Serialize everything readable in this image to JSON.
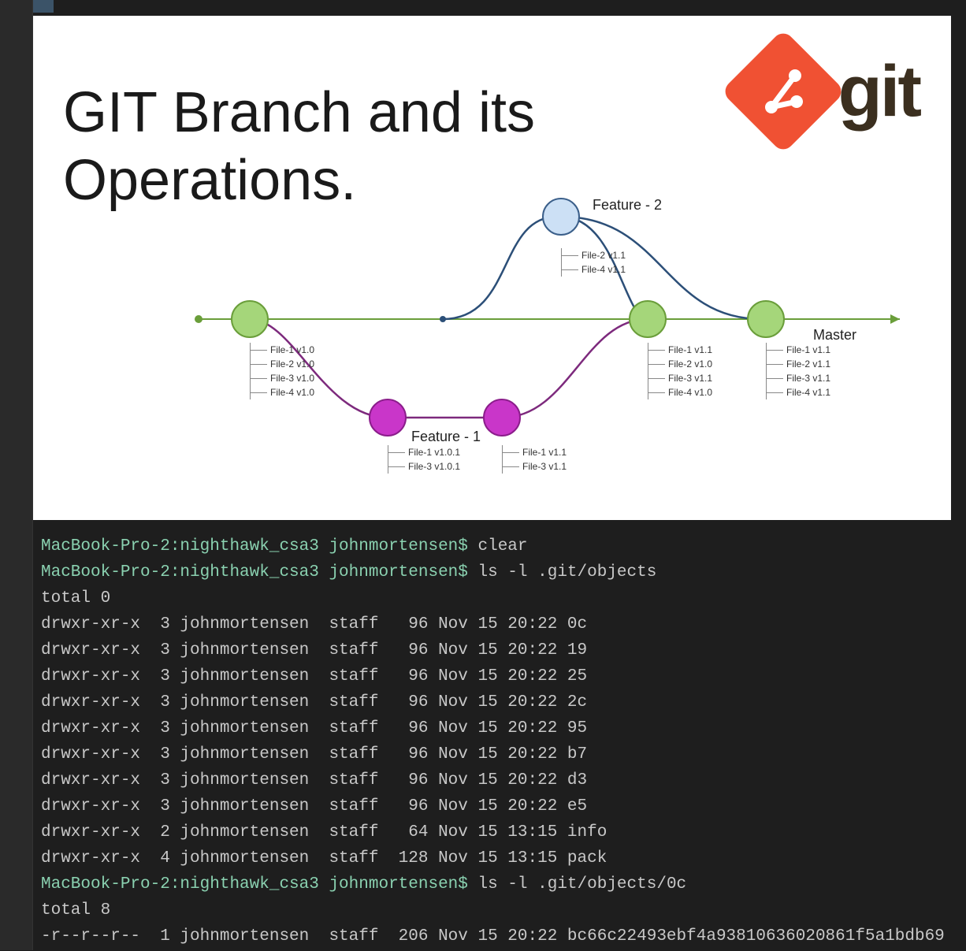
{
  "slide": {
    "title": "GIT Branch and its Operations.",
    "logo_text": "git"
  },
  "diagram": {
    "branch_master": "Master",
    "branch_feature1": "Feature - 1",
    "branch_feature2": "Feature - 2",
    "files_commit1": [
      "File-1 v1.0",
      "File-2 v1.0",
      "File-3 v1.0",
      "File-4 v1.0"
    ],
    "files_feature2": [
      "File-2 v1.1",
      "File-4 v1.1"
    ],
    "files_feature1a": [
      "File-1 v1.0.1",
      "File-3 v1.0.1"
    ],
    "files_feature1b": [
      "File-1 v1.1",
      "File-3 v1.1"
    ],
    "files_commit2": [
      "File-1 v1.1",
      "File-2 v1.0",
      "File-3 v1.1",
      "File-4 v1.0"
    ],
    "files_commit3": [
      "File-1 v1.1",
      "File-2 v1.1",
      "File-3 v1.1",
      "File-4 v1.1"
    ]
  },
  "terminal": {
    "host": "MacBook-Pro-2:nighthawk_csa3 johnmortensen$",
    "prev_cmd": "clear",
    "cmd1": "ls -l .git/objects",
    "total0": "total 0",
    "rows": [
      "drwxr-xr-x  3 johnmortensen  staff   96 Nov 15 20:22 0c",
      "drwxr-xr-x  3 johnmortensen  staff   96 Nov 15 20:22 19",
      "drwxr-xr-x  3 johnmortensen  staff   96 Nov 15 20:22 25",
      "drwxr-xr-x  3 johnmortensen  staff   96 Nov 15 20:22 2c",
      "drwxr-xr-x  3 johnmortensen  staff   96 Nov 15 20:22 95",
      "drwxr-xr-x  3 johnmortensen  staff   96 Nov 15 20:22 b7",
      "drwxr-xr-x  3 johnmortensen  staff   96 Nov 15 20:22 d3",
      "drwxr-xr-x  3 johnmortensen  staff   96 Nov 15 20:22 e5",
      "drwxr-xr-x  2 johnmortensen  staff   64 Nov 15 13:15 info",
      "drwxr-xr-x  4 johnmortensen  staff  128 Nov 15 13:15 pack"
    ],
    "cmd2": "ls -l .git/objects/0c",
    "total8": "total 8",
    "row_hash": "-r--r--r--  1 johnmortensen  staff  206 Nov 15 20:22 bc66c22493ebf4a93810636020861f5a1bdb69"
  }
}
